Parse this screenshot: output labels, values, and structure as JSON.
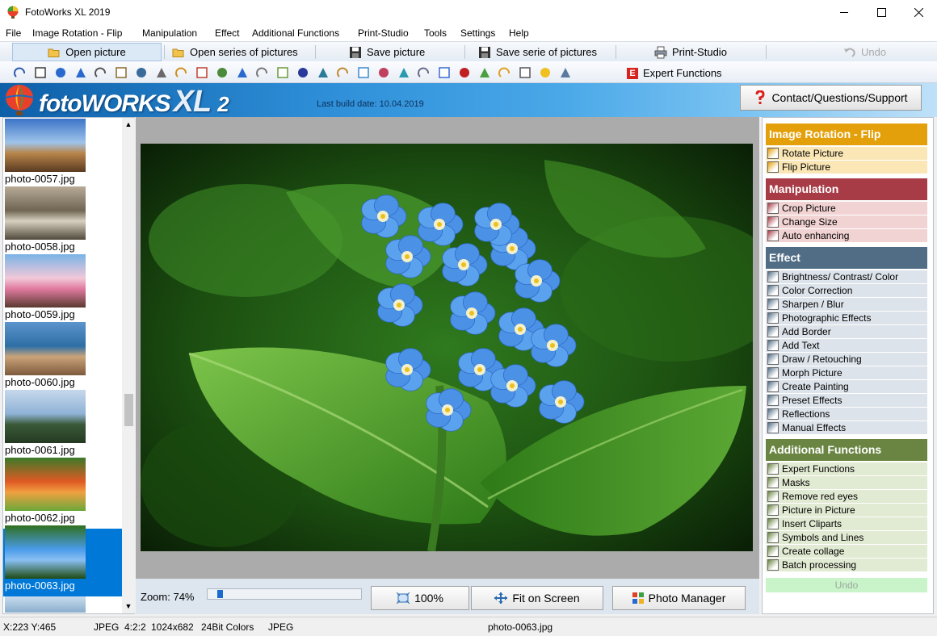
{
  "window": {
    "title": "FotoWorks XL 2019"
  },
  "menu": [
    "File",
    "Image Rotation - Flip",
    "Manipulation",
    "Effect",
    "Additional Functions",
    "Print-Studio",
    "Tools",
    "Settings",
    "Help"
  ],
  "toolbar": {
    "open": "Open picture",
    "open_series": "Open series of pictures",
    "save": "Save picture",
    "save_series": "Save serie of pictures",
    "print": "Print-Studio",
    "undo": "Undo"
  },
  "icon_toolbar": {
    "icons": [
      "rotate-left-icon",
      "rotate-right-icon",
      "rotate-ccw-icon",
      "rotate-cw-icon",
      "flip-icon",
      "crop-icon",
      "scissors-icon",
      "resize-icon",
      "pencil-icon",
      "levels-icon",
      "color-icon",
      "sharpen-icon",
      "camera-icon",
      "border-icon",
      "text-icon",
      "draw-icon",
      "morph-icon",
      "paint-icon",
      "preset-icon",
      "reflection-icon",
      "manual-icon",
      "mask-icon",
      "red-eye-icon",
      "picture-in-picture-icon",
      "clipart-icon",
      "symbol-icon",
      "star-icon",
      "batch-icon"
    ],
    "expert": "Expert Functions"
  },
  "banner": {
    "logo": "fotoWORKS",
    "logo_xl": "XL",
    "logo_num": "2",
    "build": "Last build date: 10.04.2019",
    "contact": "Contact/Questions/Support"
  },
  "thumbnails": [
    {
      "label": "photo-0057.jpg",
      "colors": [
        "#3c74c8",
        "#9fc4ea",
        "#b8854a",
        "#5a3a22"
      ]
    },
    {
      "label": "photo-0058.jpg",
      "colors": [
        "#b7ab98",
        "#6f6552",
        "#d7d0c0",
        "#514a3c"
      ]
    },
    {
      "label": "photo-0059.jpg",
      "colors": [
        "#7ab3e6",
        "#f2c8d8",
        "#e07aa0",
        "#5a3a30"
      ]
    },
    {
      "label": "photo-0060.jpg",
      "colors": [
        "#5d94cc",
        "#2d6fa6",
        "#caa37a",
        "#7d5a3c"
      ]
    },
    {
      "label": "photo-0061.jpg",
      "colors": [
        "#c7d8ec",
        "#8fb2d6",
        "#3a5a38",
        "#243a22"
      ]
    },
    {
      "label": "photo-0062.jpg",
      "colors": [
        "#3b7a2a",
        "#e05a24",
        "#f0a040",
        "#6aa83a"
      ]
    },
    {
      "label": "photo-0063.jpg",
      "colors": [
        "#2f6f1e",
        "#4a9bea",
        "#8ac0f2",
        "#1e4a12"
      ]
    }
  ],
  "selected_thumbnail": "photo-0063.jpg",
  "zoom": {
    "label": "Zoom:",
    "value": "74%",
    "slider_fraction": 0.1
  },
  "bottom_buttons": {
    "actual": "100%",
    "fit": "Fit on Screen",
    "manager": "Photo Manager"
  },
  "right_panel": {
    "sections": [
      {
        "title": "Image Rotation - Flip",
        "color": "#e4a00a",
        "item_bg": "#fbe7b5",
        "items": [
          {
            "label": "Rotate Picture",
            "icon": "rotate-picture-icon"
          },
          {
            "label": "Flip Picture",
            "icon": "flip-picture-icon"
          }
        ]
      },
      {
        "title": "Manipulation",
        "color": "#a83c46",
        "item_bg": "#f2d3d3",
        "items": [
          {
            "label": "Crop Picture",
            "icon": "crop-icon"
          },
          {
            "label": "Change Size",
            "icon": "resize-icon"
          },
          {
            "label": "Auto enhancing",
            "icon": "magic-wand-icon"
          }
        ]
      },
      {
        "title": "Effect",
        "color": "#516d86",
        "item_bg": "#dde3ea",
        "items": [
          {
            "label": "Brightness/ Contrast/ Color",
            "icon": "levels-icon"
          },
          {
            "label": "Color Correction",
            "icon": "color-correction-icon"
          },
          {
            "label": "Sharpen / Blur",
            "icon": "sharpen-icon"
          },
          {
            "label": "Photographic Effects",
            "icon": "camera-icon"
          },
          {
            "label": "Add Border",
            "icon": "border-icon"
          },
          {
            "label": "Add Text",
            "icon": "text-icon"
          },
          {
            "label": "Draw / Retouching",
            "icon": "draw-icon"
          },
          {
            "label": "Morph Picture",
            "icon": "morph-icon"
          },
          {
            "label": "Create Painting",
            "icon": "paint-icon"
          },
          {
            "label": "Preset Effects",
            "icon": "preset-icon"
          },
          {
            "label": "Reflections",
            "icon": "reflection-icon"
          },
          {
            "label": "Manual Effects",
            "icon": "manual-icon"
          }
        ]
      },
      {
        "title": "Additional Functions",
        "color": "#6a8542",
        "item_bg": "#e1ead2",
        "items": [
          {
            "label": "Expert Functions",
            "icon": "expert-icon"
          },
          {
            "label": "Masks",
            "icon": "mask-icon"
          },
          {
            "label": "Remove red eyes",
            "icon": "red-eye-icon"
          },
          {
            "label": "Picture in Picture",
            "icon": "picture-in-picture-icon"
          },
          {
            "label": "Insert Cliparts",
            "icon": "clipart-icon"
          },
          {
            "label": "Symbols and Lines",
            "icon": "symbol-icon"
          },
          {
            "label": "Create collage",
            "icon": "star-icon"
          },
          {
            "label": "Batch processing",
            "icon": "batch-icon"
          }
        ]
      }
    ],
    "undo": "Undo"
  },
  "status": {
    "coords": "X:223 Y:465",
    "format": "JPEG  4:2:2",
    "size": "1024x682",
    "colors": "24Bit Colors",
    "type": "JPEG",
    "file": "photo-0063.jpg"
  }
}
